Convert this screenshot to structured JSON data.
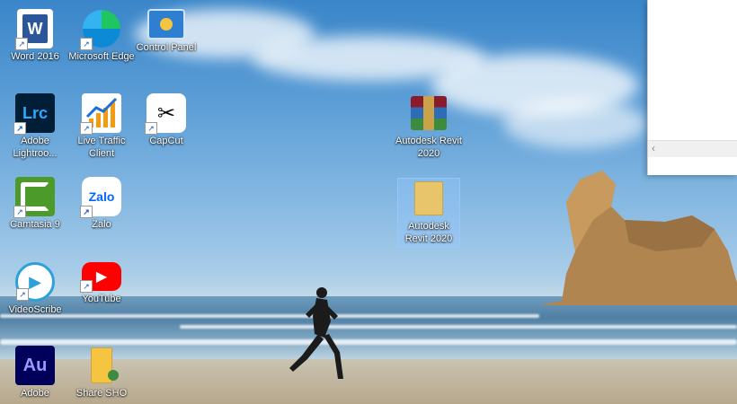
{
  "desktop": {
    "icons": [
      {
        "label": "Word 2016",
        "icon": "word-icon",
        "color": "#2b579a"
      },
      {
        "label": "Microsoft Edge",
        "icon": "edge-icon",
        "color": "#0c8ad6"
      },
      {
        "label": "Control Panel",
        "icon": "control-panel-icon",
        "color": "#2f7fd1"
      },
      {
        "label": "Adobe Lightroo...",
        "icon": "lightroom-icon",
        "color": "#001e36"
      },
      {
        "label": "Live Traffic Client",
        "icon": "live-traffic-icon",
        "color": "#ffffff"
      },
      {
        "label": "CapCut",
        "icon": "capcut-icon",
        "color": "#ffffff"
      },
      {
        "label": "Autodesk Revit 2020",
        "icon": "winrar-archive-icon",
        "color": "#8b1a2b"
      },
      {
        "label": "Camtasia 9",
        "icon": "camtasia-icon",
        "color": "#4c9a2a"
      },
      {
        "label": "Zalo",
        "icon": "zalo-icon",
        "color": "#0068ff"
      },
      {
        "label": "Autodesk Revit 2020",
        "icon": "folder-icon",
        "color": "#e8c46a"
      },
      {
        "label": "VideoScribe",
        "icon": "videoscribe-icon",
        "color": "#2ea0d8"
      },
      {
        "label": "YouTube",
        "icon": "youtube-icon",
        "color": "#ff0000"
      },
      {
        "label": "Adobe",
        "icon": "audition-icon",
        "color": "#00005b"
      },
      {
        "label": "Share SHO",
        "icon": "share-folder-icon",
        "color": "#f5c542"
      }
    ],
    "glyphs": {
      "word": "W",
      "lightroom": "Lrc",
      "capcut": "✂",
      "zalo": "Zalo",
      "audition": "Au",
      "youtube": "▶",
      "videoscribe": "▶",
      "shortcut": "↗"
    }
  },
  "window": {
    "scroll_left_glyph": "‹"
  }
}
